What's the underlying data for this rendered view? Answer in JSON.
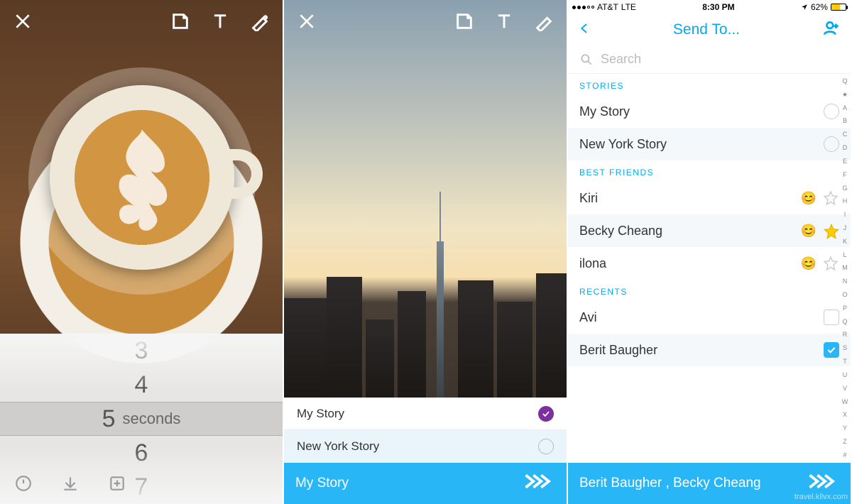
{
  "screen1": {
    "picker": {
      "values": [
        "3",
        "4",
        "5",
        "6",
        "7"
      ],
      "unit_label": "seconds",
      "selected_index": 2
    }
  },
  "screen2": {
    "stories": [
      {
        "label": "My Story",
        "checked": true
      },
      {
        "label": "New York Story",
        "checked": false
      }
    ],
    "send_label": "My Story"
  },
  "screen3": {
    "statusbar": {
      "carrier": "AT&T",
      "network": "LTE",
      "time": "8:30 PM",
      "battery_pct": "62%"
    },
    "title": "Send To...",
    "search_placeholder": "Search",
    "sections": {
      "stories_hdr": "STORIES",
      "bestfriends_hdr": "BEST FRIENDS",
      "recents_hdr": "RECENTS"
    },
    "stories": [
      {
        "label": "My Story"
      },
      {
        "label": "New York Story"
      }
    ],
    "best_friends": [
      {
        "label": "Kiri",
        "starred": false
      },
      {
        "label": "Becky Cheang",
        "starred": true
      },
      {
        "label": "ilona",
        "starred": false
      }
    ],
    "recents": [
      {
        "label": "Avi",
        "checked": false
      },
      {
        "label": "Berit Baugher",
        "checked": true
      }
    ],
    "send_label": "Berit Baugher , Becky Cheang",
    "index_letters": [
      "Q",
      "★",
      "A",
      "B",
      "C",
      "D",
      "E",
      "F",
      "G",
      "H",
      "I",
      "J",
      "K",
      "L",
      "M",
      "N",
      "O",
      "P",
      "Q",
      "R",
      "S",
      "T",
      "U",
      "V",
      "W",
      "X",
      "Y",
      "Z",
      "#"
    ]
  },
  "watermark": "travel.kllvx.com"
}
